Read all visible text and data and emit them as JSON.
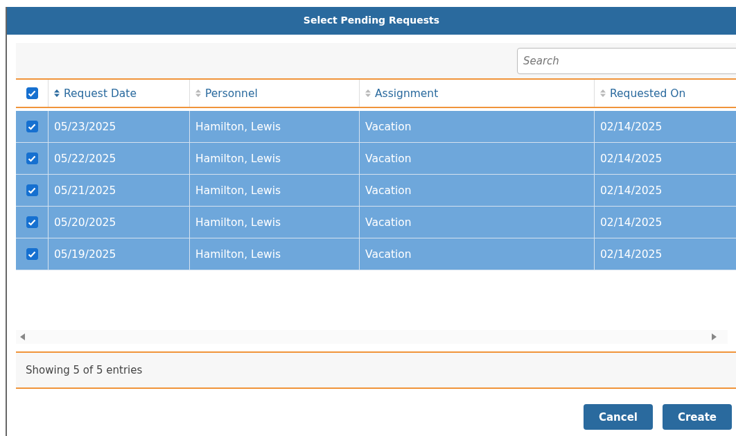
{
  "dialog": {
    "title": "Select Pending Requests"
  },
  "search": {
    "placeholder": "Search"
  },
  "table": {
    "select_all": {
      "checked": true
    },
    "columns": [
      {
        "label": "Request Date",
        "sorted": true
      },
      {
        "label": "Personnel",
        "sorted": false
      },
      {
        "label": "Assignment",
        "sorted": false
      },
      {
        "label": "Requested On",
        "sorted": false
      }
    ],
    "rows": [
      {
        "selected": true,
        "checked": true,
        "cells": [
          "05/23/2025",
          "Hamilton, Lewis",
          "Vacation",
          "02/14/2025"
        ]
      },
      {
        "selected": true,
        "checked": true,
        "cells": [
          "05/22/2025",
          "Hamilton, Lewis",
          "Vacation",
          "02/14/2025"
        ]
      },
      {
        "selected": true,
        "checked": true,
        "cells": [
          "05/21/2025",
          "Hamilton, Lewis",
          "Vacation",
          "02/14/2025"
        ]
      },
      {
        "selected": true,
        "checked": true,
        "cells": [
          "05/20/2025",
          "Hamilton, Lewis",
          "Vacation",
          "02/14/2025"
        ]
      },
      {
        "selected": true,
        "checked": true,
        "cells": [
          "05/19/2025",
          "Hamilton, Lewis",
          "Vacation",
          "02/14/2025"
        ]
      }
    ]
  },
  "footer": {
    "info": "Showing 5 of 5 entries"
  },
  "buttons": [
    {
      "label": "Cancel"
    },
    {
      "label": "Create"
    }
  ]
}
